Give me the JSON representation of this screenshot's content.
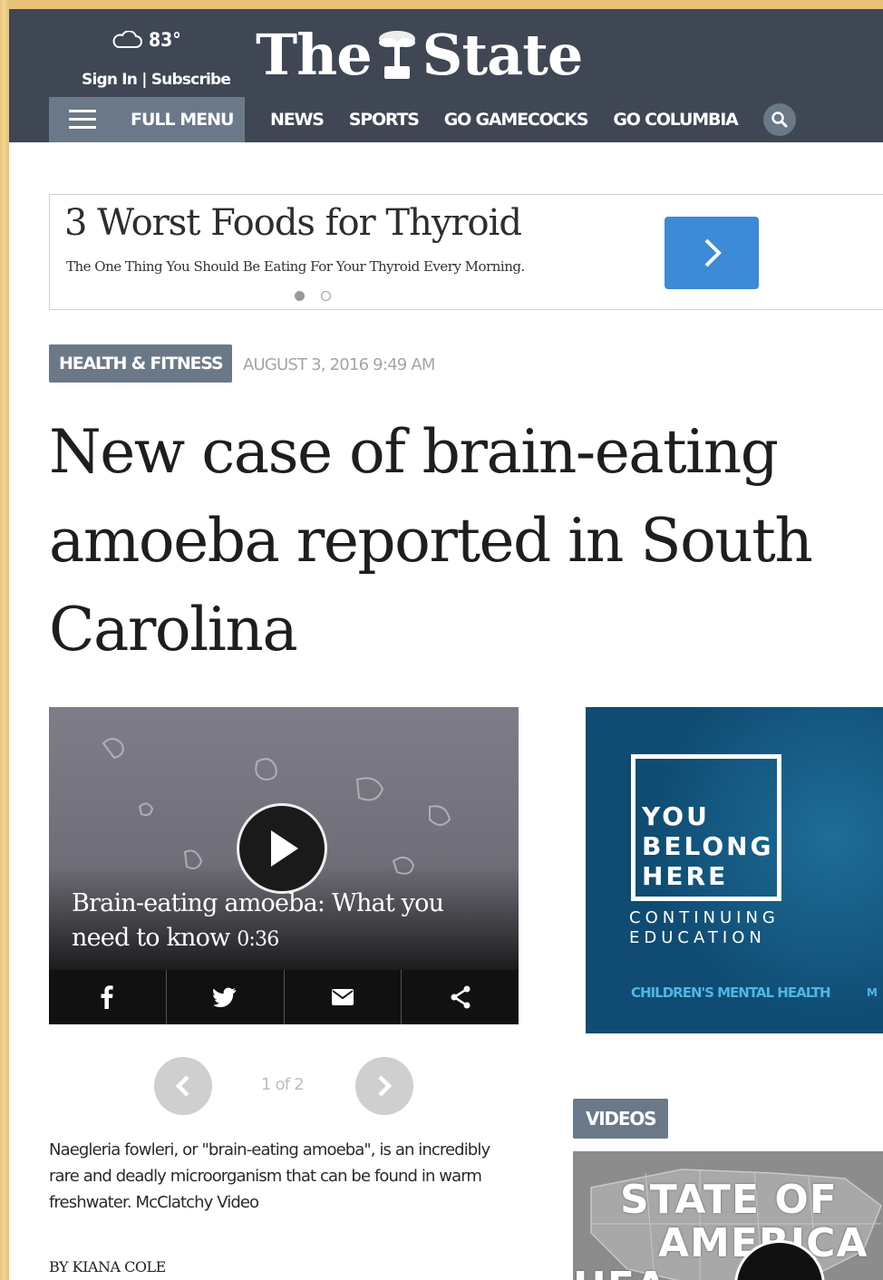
{
  "header": {
    "weather_temp": "83°",
    "weather_icon": "cloud-icon",
    "signin_label": "Sign In | Subscribe",
    "logo_left": "The",
    "logo_right": "State",
    "full_menu_label": "FULL MENU",
    "nav": [
      "NEWS",
      "SPORTS",
      "GO GAMECOCKS",
      "GO COLUMBIA"
    ],
    "search_icon": "search-icon"
  },
  "ad": {
    "title": "3 Worst Foods for Thyroid",
    "subtitle": "The One Thing You Should Be Eating For Your Thyroid Every Morning.",
    "active_dot": 0,
    "accent": "#3d8ad6"
  },
  "article": {
    "section": "HEALTH & FITNESS",
    "date": "AUGUST 3, 2016 9:49 AM",
    "headline": "New case of brain-eating amoeba reported in South Carolina",
    "video_title": "Brain-eating amoeba: What you need to know",
    "video_duration": "0:36",
    "pager": "1 of 2",
    "description": "Naegleria fowleri, or \"brain-eating amoeba\", is an incredibly rare and deadly microorganism that can be found in warm freshwater. McClatchy Video",
    "byline": "BY KIANA COLE"
  },
  "right_ad": {
    "headline_lines": [
      "YOU",
      "BELONG",
      "HERE"
    ],
    "sub_lines": [
      "CONTINUING",
      "EDUCATION"
    ],
    "link": "CHILDREN'S MENTAL HEALTH",
    "link2": "M"
  },
  "videos": {
    "label": "VIDEOS",
    "thumb_lines": [
      "STATE OF",
      "AMERICA",
      "HEA"
    ]
  },
  "colors": {
    "header_bg": "#3e4753",
    "tag_bg": "#6b7888",
    "ad_accent": "#3d8ad6"
  }
}
